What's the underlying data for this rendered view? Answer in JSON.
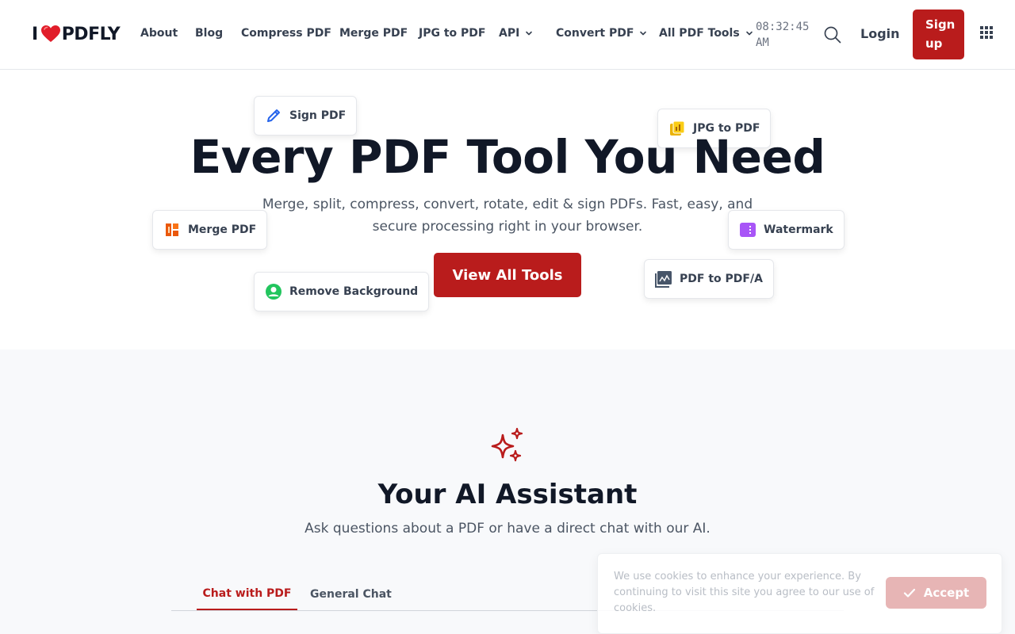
{
  "header": {
    "logo": {
      "prefix": "I",
      "icon": "heart-icon",
      "name": "PDFLY",
      "heart_color": "#e11d2a"
    },
    "nav": [
      {
        "label": "About"
      },
      {
        "label": "Blog"
      },
      {
        "label": "Compress PDF"
      },
      {
        "label": "Merge PDF"
      },
      {
        "label": "JPG to PDF"
      },
      {
        "label": "API",
        "dropdown": true
      },
      {
        "label": "Convert PDF",
        "dropdown": true
      },
      {
        "label": "All PDF Tools",
        "dropdown": true
      }
    ],
    "clock_time": "08:32:45",
    "clock_period": "AM",
    "search_icon": "search-icon",
    "login_label": "Login",
    "signup_line1": "Sign",
    "signup_line2": "up",
    "apps_icon": "grid-icon"
  },
  "hero": {
    "title": "Every PDF Tool You Need",
    "subtitle": "Merge, split, compress, convert, rotate, edit & sign PDFs. Fast, easy, and secure processing right in your browser.",
    "cta": "View All Tools",
    "chips": [
      {
        "label": "Sign PDF",
        "icon": "pencil-icon",
        "color": "#2563eb"
      },
      {
        "label": "JPG to PDF",
        "icon": "image-stack-icon",
        "color": "#eab308"
      },
      {
        "label": "Merge PDF",
        "icon": "merge-icon",
        "color": "#ea580c"
      },
      {
        "label": "Watermark",
        "icon": "watermark-icon",
        "color": "#a855f7"
      },
      {
        "label": "Remove Background",
        "icon": "person-icon",
        "color": "#22c55e"
      },
      {
        "label": "PDF to PDF/A",
        "icon": "chart-image-icon",
        "color": "#475569"
      }
    ]
  },
  "ai": {
    "icon": "sparkle-icon",
    "title": "Your AI Assistant",
    "subtitle": "Ask questions about a PDF or have a direct chat with our AI.",
    "tabs": [
      {
        "label": "Chat with PDF",
        "active": true
      },
      {
        "label": "General Chat",
        "active": false
      }
    ]
  },
  "cookie": {
    "text": "We use cookies to enhance your experience. By continuing to visit this site you agree to our use of cookies.",
    "accept": "Accept"
  },
  "colors": {
    "brand": "#b91c1c",
    "text": "#111827",
    "muted": "#4b5563",
    "section_bg": "#f8f9fb"
  }
}
